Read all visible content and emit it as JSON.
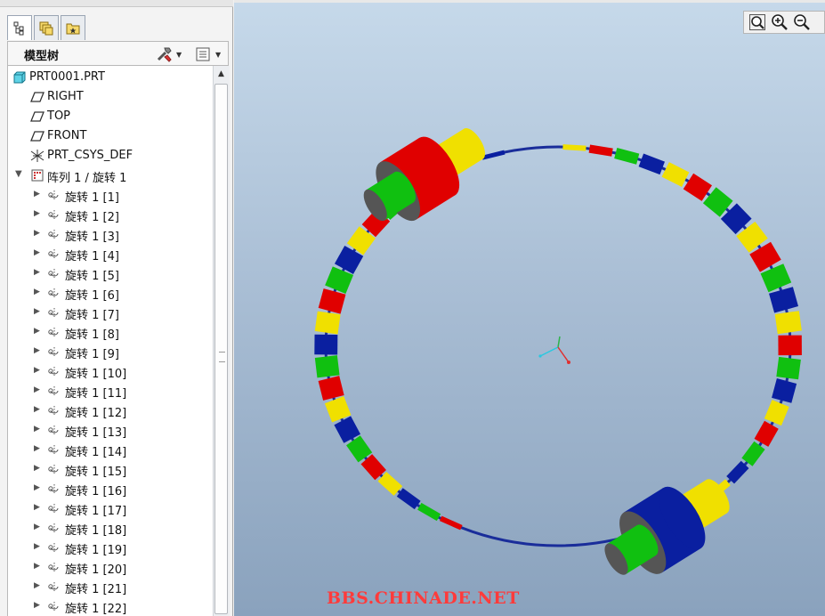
{
  "panel": {
    "title": "模型树",
    "tabs": [
      "model-tree-icon",
      "layers-icon",
      "favorites-icon"
    ]
  },
  "tree": {
    "root": "PRT0001.PRT",
    "datums": [
      {
        "label": "RIGHT",
        "icon": "datum-plane-icon"
      },
      {
        "label": "TOP",
        "icon": "datum-plane-icon"
      },
      {
        "label": "FRONT",
        "icon": "datum-plane-icon"
      },
      {
        "label": "PRT_CSYS_DEF",
        "icon": "coordinate-system-icon"
      }
    ],
    "pattern": "阵列 1 / 旋转 1",
    "children": [
      "旋转 1 [1]",
      "旋转 1 [2]",
      "旋转 1 [3]",
      "旋转 1 [4]",
      "旋转 1 [5]",
      "旋转 1 [6]",
      "旋转 1 [7]",
      "旋转 1 [8]",
      "旋转 1 [9]",
      "旋转 1 [10]",
      "旋转 1 [11]",
      "旋转 1 [12]",
      "旋转 1 [13]",
      "旋转 1 [14]",
      "旋转 1 [15]",
      "旋转 1 [16]",
      "旋转 1 [17]",
      "旋转 1 [18]",
      "旋转 1 [19]",
      "旋转 1 [20]",
      "旋转 1 [21]",
      "旋转 1 [22]"
    ]
  },
  "viewer": {
    "tools": [
      "zoom-fit-icon",
      "zoom-in-icon",
      "zoom-out-icon"
    ],
    "watermark": "BBS.CHINADE.NET"
  },
  "colors": {
    "red": "#e00000",
    "yellow": "#f0e000",
    "green": "#10c010",
    "blue": "#0a1fa0"
  }
}
